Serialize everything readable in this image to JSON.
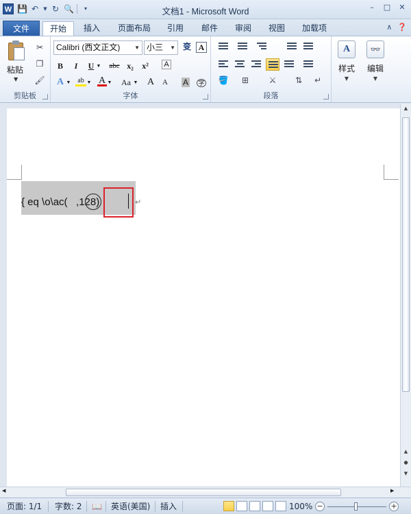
{
  "window": {
    "title": "文档1 - Microsoft Word",
    "app_icon": "W"
  },
  "tabs": {
    "file": "文件",
    "items": [
      "开始",
      "插入",
      "页面布局",
      "引用",
      "邮件",
      "审阅",
      "视图",
      "加载项"
    ]
  },
  "ribbon": {
    "clipboard": {
      "paste_label": "粘贴",
      "group_label": "剪贴板"
    },
    "font": {
      "font_name": "Calibri (西文正文)",
      "font_size": "小三",
      "wen_label": "变",
      "a_label": "A",
      "bold": "B",
      "italic": "I",
      "underline": "U",
      "strike": "abc",
      "subscript": "x₂",
      "superscript": "x²",
      "clear_format": "A",
      "highlight": "ab",
      "font_color": "A",
      "change_case": "Aa",
      "grow": "A",
      "shrink": "A",
      "char_shading": "A",
      "enclose": "字",
      "text_effect": "A",
      "group_label": "字体"
    },
    "paragraph": {
      "group_label": "段落"
    },
    "styles": {
      "label": "样式",
      "icon": "A"
    },
    "editing": {
      "label": "编辑",
      "icon": "🔍"
    }
  },
  "document": {
    "field_code": "{ eq \\o\\ac(   ,128)",
    "paragraph_mark": "↵"
  },
  "statusbar": {
    "page": "页面: 1/1",
    "words": "字数: 2",
    "language": "英语(美国)",
    "insert_mode": "插入",
    "zoom": "100%"
  },
  "colors": {
    "file_tab": "#2a5ea8",
    "highlight_box": "#d9232a",
    "field_shading": "#c8c8c8"
  }
}
